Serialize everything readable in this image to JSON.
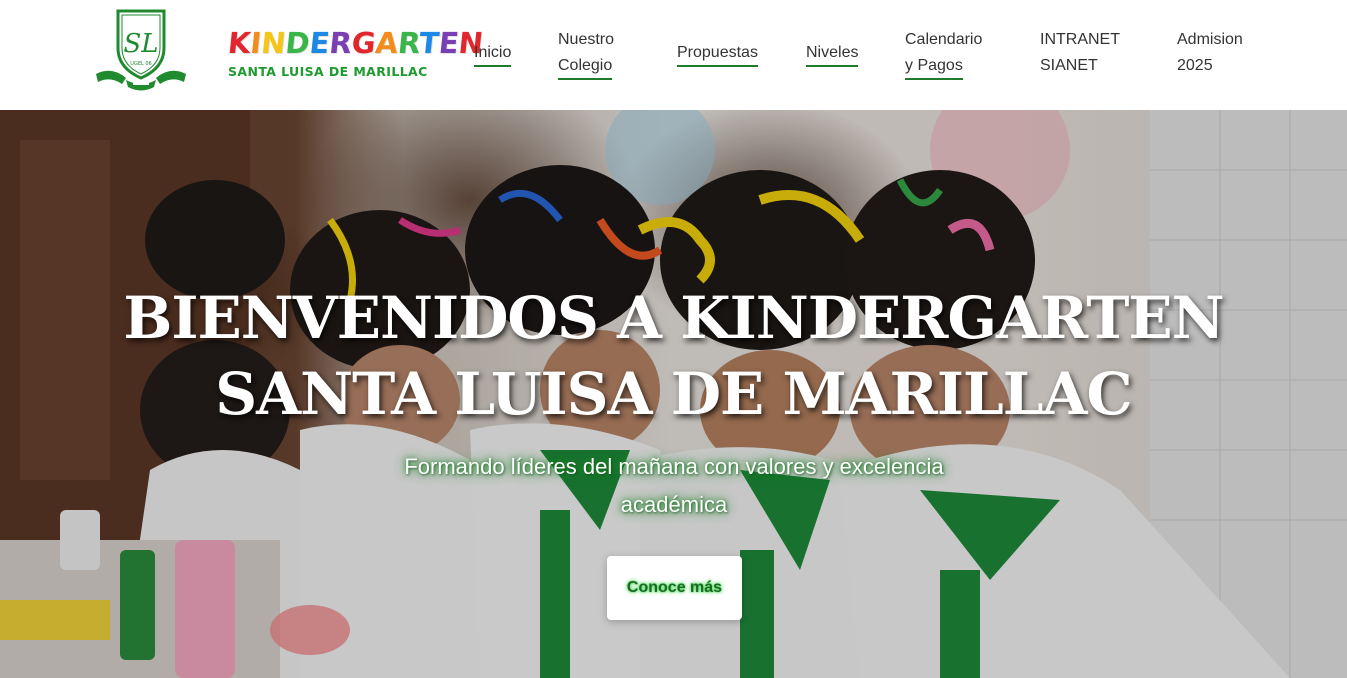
{
  "header": {
    "crest": {
      "initials": "SL",
      "ugel": "UGEL 06"
    },
    "brand": {
      "word": [
        "K",
        "I",
        "N",
        "D",
        "E",
        "R",
        "G",
        "A",
        "R",
        "T",
        "E",
        "N"
      ],
      "word_colors": [
        "#e2262d",
        "#f28c1a",
        "#f5c518",
        "#3ab54a",
        "#1e88e5",
        "#7b3fb4",
        "#e2262d",
        "#f28c1a",
        "#3ab54a",
        "#1e88e5",
        "#7b3fb4",
        "#e2262d"
      ],
      "subtitle": "SANTA LUISA DE MARILLAC"
    },
    "nav": {
      "inicio": "Inicio",
      "nuestro_colegio": [
        "Nuestro",
        "Colegio"
      ],
      "propuestas": "Propuestas",
      "niveles": "Niveles",
      "calendario": [
        "Calendario",
        "y Pagos"
      ],
      "intranet": [
        "INTRANET",
        "SIANET"
      ],
      "admision": [
        "Admision",
        "2025"
      ]
    }
  },
  "hero": {
    "title": "BIENVENIDOS A KINDERGARTEN SANTA LUISA DE MARILLAC",
    "subtitle": "Formando líderes del mañana con valores y excelencia académica",
    "button": "Conoce más"
  },
  "colors": {
    "accent_green": "#1f7a2b",
    "nav_text": "#333333"
  }
}
